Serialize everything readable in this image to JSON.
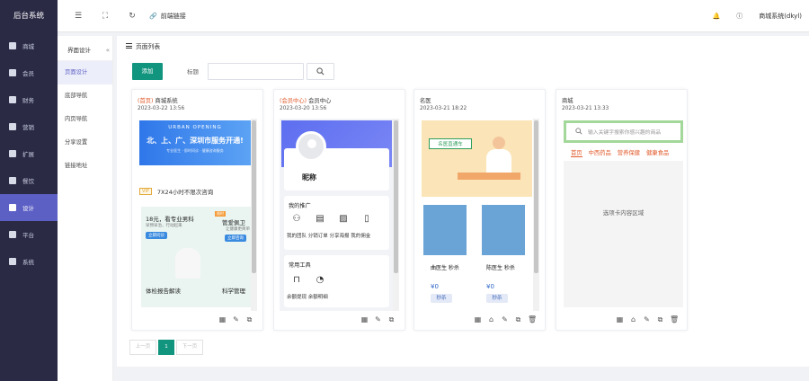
{
  "app": {
    "title": "后台系统"
  },
  "sidebar": {
    "items": [
      {
        "label": "商城",
        "icon": "shop-icon"
      },
      {
        "label": "会员",
        "icon": "member-icon"
      },
      {
        "label": "财务",
        "icon": "finance-icon"
      },
      {
        "label": "营销",
        "icon": "marketing-icon"
      },
      {
        "label": "扩展",
        "icon": "extension-icon"
      },
      {
        "label": "餐饮",
        "icon": "catering-icon"
      },
      {
        "label": "设计",
        "icon": "design-icon",
        "active": true
      },
      {
        "label": "平台",
        "icon": "platform-icon"
      },
      {
        "label": "系统",
        "icon": "system-icon"
      }
    ]
  },
  "topbar": {
    "menu_icon": "☰",
    "fullscreen_icon": "⛶",
    "refresh_icon": "↻",
    "link_label": "前端链接",
    "user": "商城系统(dkyl)"
  },
  "submenu": {
    "title": "界面设计",
    "collapse": "«",
    "items": [
      "页面设计",
      "底部导航",
      "内页导航",
      "分享设置",
      "链接地址"
    ],
    "active": 0
  },
  "main": {
    "title": "页面列表",
    "add_label": "添加",
    "filter_label": "标题",
    "filter_placeholder": "",
    "search_icon": "search-icon",
    "cards": [
      {
        "tag": "(首页)",
        "name": "商城系统",
        "date": "2023-03-22 13:56",
        "banner": {
          "line1": "URBAN OPENING",
          "line2": "北、上、广、深圳市服务开通!",
          "line3": "专业医生 · 即时问诊 · 健康咨询服务"
        },
        "vip_badge": "VIP",
        "vip_text": "7X24小时不限次咨询",
        "promo_price": "18元，看专业男科",
        "promo_sub": "早预早治，行动起来",
        "promo_btn": "立即问诊",
        "promo2_title": "管爱佩卫",
        "promo2_sub": "让健康更简单",
        "promo2_btn": "立即咨询",
        "promo3": "体检报告解读",
        "promo4": "科学管理",
        "promo_hot": "限时"
      },
      {
        "tag": "(会员中心)",
        "name": "会员中心",
        "date": "2023-03-20 13:56",
        "nickname": "昵称",
        "sec1": "我的推广",
        "sec1_items": [
          "我的团队",
          "分销订单",
          "分享海报",
          "我的佣金"
        ],
        "sec2": "常用工具",
        "sec2_items": [
          "余额提现",
          "余额明细"
        ]
      },
      {
        "tag": "",
        "name": "名医",
        "date": "2023-03-21 18:22",
        "banner_tag": "名医直通车",
        "doctors": [
          {
            "name": "曲医生 秒杀",
            "price": "¥0",
            "btn": "秒杀"
          },
          {
            "name": "陈医生 秒杀",
            "price": "¥0",
            "btn": "秒杀"
          }
        ]
      },
      {
        "tag": "",
        "name": "商城",
        "date": "2023-03-21 13:33",
        "search_placeholder": "输入关键字搜索你感兴趣的商品",
        "tabs": [
          "首页",
          "中西药品",
          "营养保健",
          "健康食品"
        ],
        "empty_text": "选项卡内容区域"
      }
    ]
  },
  "pager": {
    "prev": "上一页",
    "current": "1",
    "next": "下一页"
  },
  "colors": {
    "accent": "#12957e",
    "sidebar": "#2a2a45",
    "active": "#5c5fc4"
  }
}
